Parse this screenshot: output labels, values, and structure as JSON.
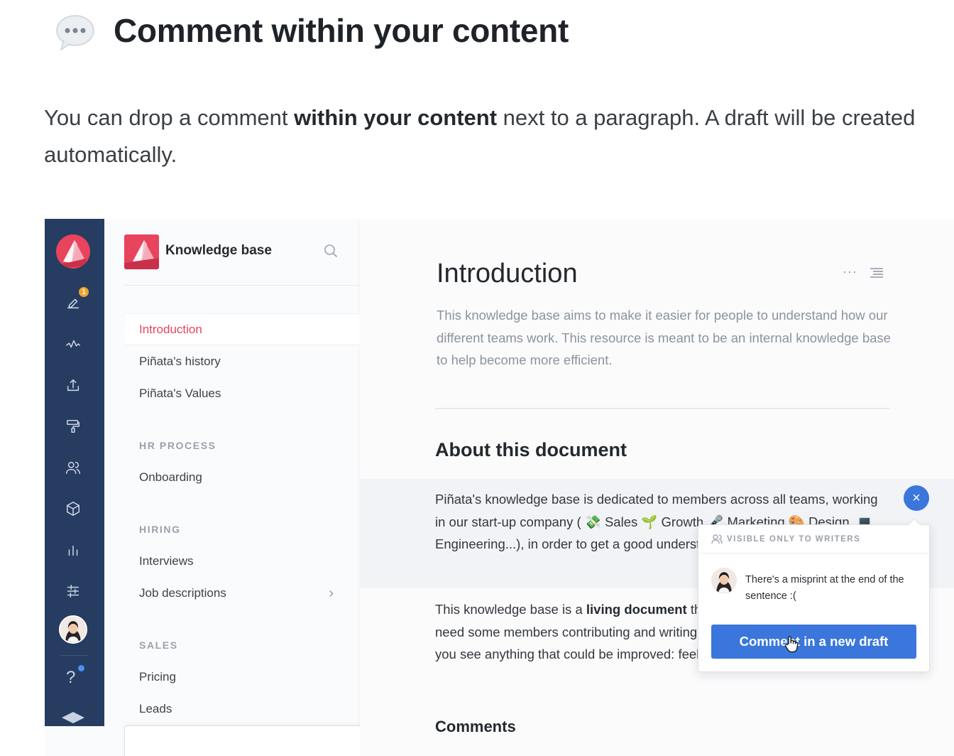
{
  "article": {
    "title": "Comment within your content",
    "intro_before": "You can drop a comment ",
    "intro_bold": "within your content",
    "intro_after": " next to a paragraph. A draft will be created automatically.",
    "header_icon": "speech-bubble-icon"
  },
  "app": {
    "rail": {
      "icons": [
        "logo-icon",
        "edit-icon",
        "activity-icon",
        "upload-icon",
        "paint-roller-icon",
        "users-icon",
        "box-icon",
        "chart-icon",
        "settings-sliders-icon",
        "avatar",
        "help-icon",
        "graduation-cap-icon"
      ],
      "edit_badge": "1",
      "help_label": "?"
    },
    "sidebar": {
      "title": "Knowledge base",
      "items": [
        {
          "label": "Introduction",
          "active": true
        },
        {
          "label": "Piñata's history"
        },
        {
          "label": "Piñata's Values"
        }
      ],
      "sections": [
        {
          "title": "HR PROCESS",
          "items": [
            {
              "label": "Onboarding"
            }
          ]
        },
        {
          "title": "HIRING",
          "items": [
            {
              "label": "Interviews"
            },
            {
              "label": "Job descriptions",
              "chevron": "›"
            }
          ]
        },
        {
          "title": "SALES",
          "items": [
            {
              "label": "Pricing"
            },
            {
              "label": "Leads"
            }
          ]
        }
      ]
    },
    "document": {
      "title": "Introduction",
      "more_label": "···",
      "lead": "This knowledge base aims to make it easier for people to understand how our different teams work. This resource is meant to be an internal knowledge base to help become more efficient.",
      "section_title": "About this document",
      "para1": "Piñata's knowledge base is dedicated to members across all teams, working in our start-up company ( 💸 Sales 🌱 Growth 🎤 Marketing 🎨 Design, 💻 Engineering...), in order to get a good understanding of our processes.2",
      "para2_before": "This knowledge base is a ",
      "para2_bold": "living document",
      "para2_after": " that evolves over time, so we need some members contributing and writing new sections to document, if you see anything that could be improved: feel free to edit! 😀",
      "comments_title": "Comments"
    },
    "comment_popover": {
      "visibility": "VISIBLE ONLY TO WRITERS",
      "text": "There's a misprint at the end of the sentence :(",
      "button": "Comment in a new draft",
      "close_label": "×"
    },
    "colors": {
      "rail": "#263c61",
      "brand": "#e8445d",
      "primary": "#3b76dd"
    }
  }
}
